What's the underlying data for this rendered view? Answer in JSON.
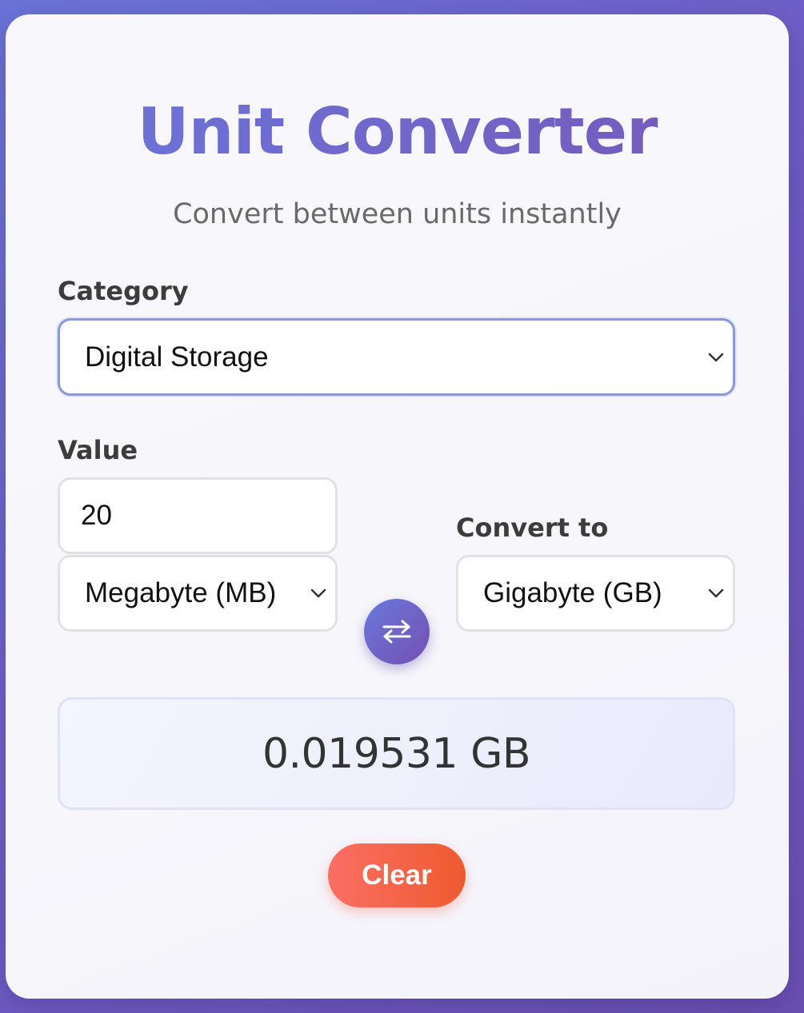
{
  "app": {
    "title": "Unit Converter",
    "subtitle": "Convert between units instantly"
  },
  "category": {
    "label": "Category",
    "selected": "Digital Storage"
  },
  "from": {
    "label": "Value",
    "value": "20",
    "unit": "Megabyte (MB)"
  },
  "to": {
    "label": "Convert to",
    "unit": "Gigabyte (GB)"
  },
  "swap": {
    "icon": "swap-arrows-icon"
  },
  "result": {
    "text": "0.019531 GB"
  },
  "actions": {
    "clear_label": "Clear"
  },
  "colors": {
    "background": "#6e5cc4",
    "accent_start": "#6b77dc",
    "accent_end": "#7657b8",
    "clear_start": "#fb6f64",
    "clear_end": "#ee5a30"
  }
}
